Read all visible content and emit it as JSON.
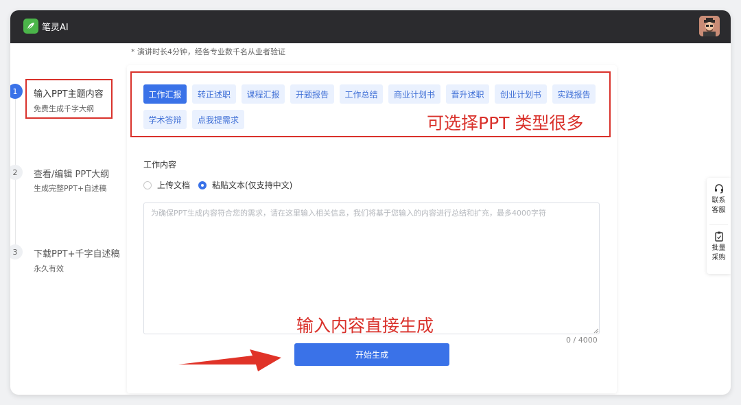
{
  "app": {
    "title": "笔灵AI"
  },
  "note": "* 演讲时长4分钟，经各专业数千名从业者验证",
  "steps": [
    {
      "num": "1",
      "title": "输入PPT主题内容",
      "sub": "免费生成千字大纲"
    },
    {
      "num": "2",
      "title": "查看/编辑 PPT大纲",
      "sub": "生成完整PPT+自述稿"
    },
    {
      "num": "3",
      "title": "下载PPT+千字自述稿",
      "sub": "永久有效"
    }
  ],
  "tags": [
    "工作汇报",
    "转正述职",
    "课程汇报",
    "开题报告",
    "工作总结",
    "商业计划书",
    "晋升述职",
    "创业计划书",
    "实践报告",
    "学术答辩",
    "点我提需求"
  ],
  "annotations": {
    "types": "可选择PPT 类型很多",
    "input": "输入内容直接生成"
  },
  "form": {
    "label": "工作内容",
    "radio_upload": "上传文档",
    "radio_paste": "粘贴文本(仅支持中文)",
    "placeholder": "为确保PPT生成内容符合您的需求，请在这里输入相关信息，我们将基于您输入的内容进行总结和扩充，最多4000字符",
    "counter": "0 / 4000",
    "submit": "开始生成"
  },
  "side": {
    "service": "联系客服",
    "bulk": "批量采购"
  },
  "colors": {
    "accent": "#3a72e8",
    "annotation": "#d9312b",
    "topbar": "#2b2b2e"
  }
}
